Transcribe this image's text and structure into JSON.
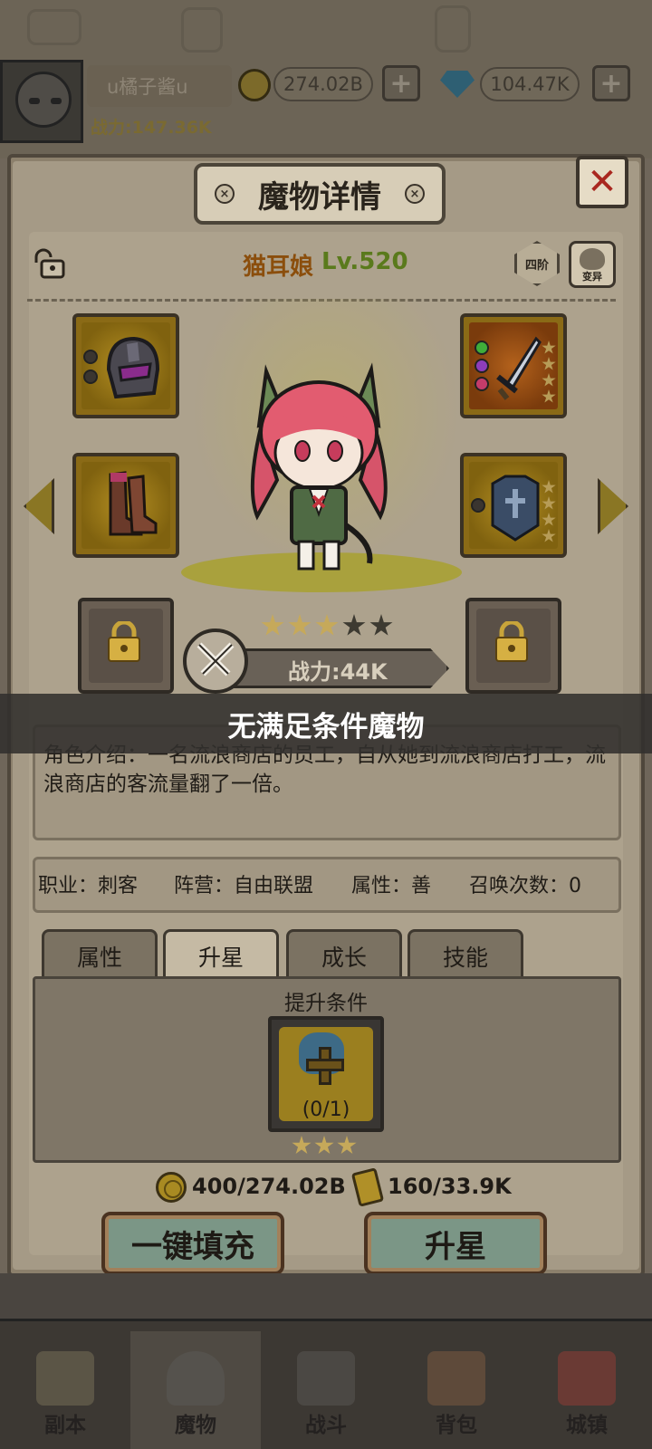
{
  "top_bar": {
    "player_name": "u橘子酱u",
    "power_label": "战力:147.36K",
    "gold": "274.02B",
    "gems": "104.47K",
    "plus": "+"
  },
  "panel": {
    "title": "魔物详情",
    "close": "✕",
    "title_deco": "×"
  },
  "monster": {
    "name": "猫耳娘",
    "level": "Lv.520",
    "rank": "四阶",
    "mutate_label": "变异",
    "stars_filled": 3,
    "stars_total": 5,
    "power": "战力:44K"
  },
  "toast": "无满足条件魔物",
  "description": "角色介绍：一名流浪商店的员工，自从她到流浪商店打工，流浪商店的客流量翻了一倍。",
  "info": {
    "job": "职业：刺客",
    "camp": "阵营：自由联盟",
    "attribute": "属性：善",
    "summons": "召唤次数：0"
  },
  "tabs": [
    "属性",
    "升星",
    "成长",
    "技能"
  ],
  "active_tab": "升星",
  "upgrade": {
    "condition_title": "提升条件",
    "requirement_count": "(0/1)",
    "requirement_stars": 3,
    "gold_cost": "400/274.02B",
    "scroll_cost": "160/33.9K"
  },
  "buttons": {
    "auto_fill": "一键填充",
    "star_up": "升星"
  },
  "nav": [
    "副本",
    "魔物",
    "战斗",
    "背包",
    "城镇"
  ],
  "colors": {
    "panel": "#a59a86",
    "gold_slot": "#8a6a16",
    "accent_button": "#7b9686",
    "star": "#c6a95a"
  }
}
